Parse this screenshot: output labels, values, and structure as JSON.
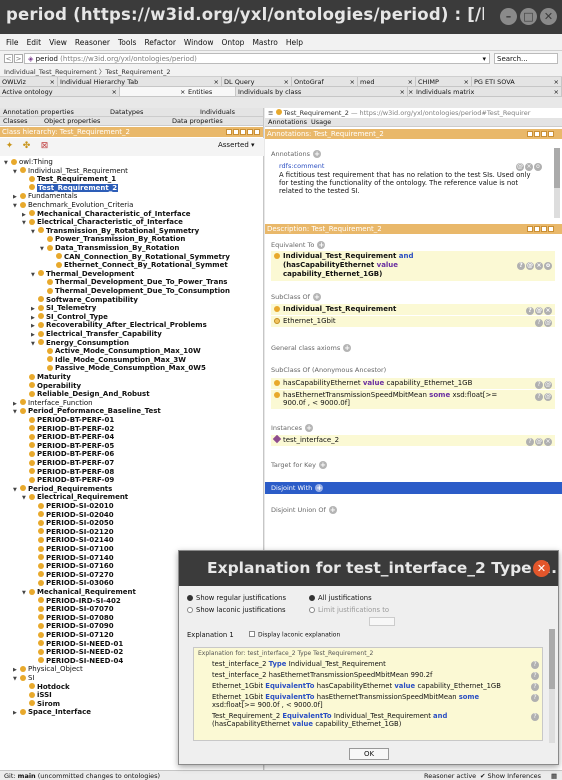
{
  "window": {
    "title": "period (https://w3id.org/yxl/ontologies/period) : [/hom..."
  },
  "menu": [
    "File",
    "Edit",
    "View",
    "Reasoner",
    "Tools",
    "Refactor",
    "Window",
    "Ontop",
    "Mastro",
    "Help"
  ],
  "address": {
    "nav_back": "<",
    "nav_fwd": ">",
    "ontology": "period",
    "url": "(https://w3id.org/yxl/ontologies/period)",
    "search": "Search...",
    "breadcrumb": "Individual_Test_Requirement 〉Test_Requirement_2"
  },
  "tabs_row1": [
    "OWLViz",
    "Individual Hierarchy Tab",
    "DL Query",
    "OntoGraf",
    "med",
    "CHIMP",
    "PG ETI SOVA"
  ],
  "tabs_row2": [
    "Active ontology",
    "Entities",
    "Individuals by class",
    "Individuals matrix"
  ],
  "left": {
    "subtabs_a": [
      "Annotation properties",
      "Datatypes",
      "Individuals"
    ],
    "subtabs_b": [
      "Classes",
      "Object properties",
      "Data properties"
    ],
    "panel_title": "Class hierarchy: Test_Requirement_2",
    "asserted": "Asserted",
    "tree": [
      {
        "label": "owl:Thing",
        "depth": 0,
        "tri": "▼",
        "bold": false
      },
      {
        "label": "Individual_Test_Requirement",
        "depth": 1,
        "tri": "▼",
        "bold": false
      },
      {
        "label": "Test_Requirement_1",
        "depth": 2,
        "tri": "",
        "bold": true
      },
      {
        "label": "Test_Requirement_2",
        "depth": 2,
        "tri": "",
        "bold": true,
        "selected": true
      },
      {
        "label": "Fundamentals",
        "depth": 1,
        "tri": "▶",
        "bold": false
      },
      {
        "label": "Benchmark_Evolution_Criteria",
        "depth": 1,
        "tri": "▼",
        "bold": false
      },
      {
        "label": "Mechanical_Characteristic_of_Interface",
        "depth": 2,
        "tri": "▶",
        "bold": true
      },
      {
        "label": "Electrical_Characteristic_of_Interface",
        "depth": 2,
        "tri": "▼",
        "bold": true
      },
      {
        "label": "Transmission_By_Rotational_Symmetry",
        "depth": 3,
        "tri": "▼",
        "bold": true
      },
      {
        "label": "Power_Transmission_By_Rotation",
        "depth": 4,
        "tri": "",
        "bold": true
      },
      {
        "label": "Data_Transmission_By_Rotation",
        "depth": 4,
        "tri": "▼",
        "bold": true
      },
      {
        "label": "CAN_Connection_By_Rotational_Symmetry",
        "depth": 5,
        "tri": "",
        "bold": true
      },
      {
        "label": "Ethernet_Connect_By_Rotational_Symmet",
        "depth": 5,
        "tri": "",
        "bold": true
      },
      {
        "label": "Thermal_Development",
        "depth": 3,
        "tri": "▼",
        "bold": true
      },
      {
        "label": "Thermal_Development_Due_To_Power_Trans",
        "depth": 4,
        "tri": "",
        "bold": true
      },
      {
        "label": "Thermal_Development_Due_To_Consumption",
        "depth": 4,
        "tri": "",
        "bold": true
      },
      {
        "label": "Software_Compatibility",
        "depth": 3,
        "tri": "",
        "bold": true
      },
      {
        "label": "SI_Telemetry",
        "depth": 3,
        "tri": "▶",
        "bold": true
      },
      {
        "label": "SI_Control_Type",
        "depth": 3,
        "tri": "▶",
        "bold": true
      },
      {
        "label": "Recoverability_After_Electrical_Problems",
        "depth": 3,
        "tri": "▶",
        "bold": true
      },
      {
        "label": "Electrical_Transfer_Capability",
        "depth": 3,
        "tri": "▶",
        "bold": true
      },
      {
        "label": "Energy_Consumption",
        "depth": 3,
        "tri": "▼",
        "bold": true
      },
      {
        "label": "Active_Mode_Consumption_Max_10W",
        "depth": 4,
        "tri": "",
        "bold": true
      },
      {
        "label": "Idle_Mode_Consumption_Max_3W",
        "depth": 4,
        "tri": "",
        "bold": true
      },
      {
        "label": "Passive_Mode_Consumption_Max_0W5",
        "depth": 4,
        "tri": "",
        "bold": true
      },
      {
        "label": "Maturity",
        "depth": 2,
        "tri": "",
        "bold": true
      },
      {
        "label": "Operability",
        "depth": 2,
        "tri": "",
        "bold": true
      },
      {
        "label": "Reliable_Design_And_Robust",
        "depth": 2,
        "tri": "",
        "bold": true
      },
      {
        "label": "Interface_Function",
        "depth": 1,
        "tri": "▶",
        "bold": false
      },
      {
        "label": "Period_Peformance_Baseline_Test",
        "depth": 1,
        "tri": "▼",
        "bold": true
      },
      {
        "label": "PERIOD-BT-PERF-01",
        "depth": 2,
        "tri": "",
        "bold": true
      },
      {
        "label": "PERIOD-BT-PERF-02",
        "depth": 2,
        "tri": "",
        "bold": true
      },
      {
        "label": "PERIOD-BT-PERF-04",
        "depth": 2,
        "tri": "",
        "bold": true
      },
      {
        "label": "PERIOD-BT-PERF-05",
        "depth": 2,
        "tri": "",
        "bold": true
      },
      {
        "label": "PERIOD-BT-PERF-06",
        "depth": 2,
        "tri": "",
        "bold": true
      },
      {
        "label": "PERIOD-BT-PERF-07",
        "depth": 2,
        "tri": "",
        "bold": true
      },
      {
        "label": "PERIOD-BT-PERF-08",
        "depth": 2,
        "tri": "",
        "bold": true
      },
      {
        "label": "PERIOD-BT-PERF-09",
        "depth": 2,
        "tri": "",
        "bold": true
      },
      {
        "label": "Period_Requirements",
        "depth": 1,
        "tri": "▼",
        "bold": true
      },
      {
        "label": "Electrical_Requirement",
        "depth": 2,
        "tri": "▼",
        "bold": true
      },
      {
        "label": "PERIOD-SI-02010",
        "depth": 3,
        "tri": "",
        "bold": true
      },
      {
        "label": "PERIOD-SI-02040",
        "depth": 3,
        "tri": "",
        "bold": true
      },
      {
        "label": "PERIOD-SI-02050",
        "depth": 3,
        "tri": "",
        "bold": true
      },
      {
        "label": "PERIOD-SI-02120",
        "depth": 3,
        "tri": "",
        "bold": true
      },
      {
        "label": "PERIOD-SI-02140",
        "depth": 3,
        "tri": "",
        "bold": true
      },
      {
        "label": "PERIOD-SI-07100",
        "depth": 3,
        "tri": "",
        "bold": true
      },
      {
        "label": "PERIOD-SI-07140",
        "depth": 3,
        "tri": "",
        "bold": true
      },
      {
        "label": "PERIOD-SI-07160",
        "depth": 3,
        "tri": "",
        "bold": true
      },
      {
        "label": "PERIOD-SI-07270",
        "depth": 3,
        "tri": "",
        "bold": true
      },
      {
        "label": "PERIOD-SI-03060",
        "depth": 3,
        "tri": "",
        "bold": true
      },
      {
        "label": "Mechanical_Requirement",
        "depth": 2,
        "tri": "▼",
        "bold": true
      },
      {
        "label": "PERIOD-IRD-SI-402",
        "depth": 3,
        "tri": "",
        "bold": true
      },
      {
        "label": "PERIOD-SI-07070",
        "depth": 3,
        "tri": "",
        "bold": true
      },
      {
        "label": "PERIOD-SI-07080",
        "depth": 3,
        "tri": "",
        "bold": true
      },
      {
        "label": "PERIOD-SI-07090",
        "depth": 3,
        "tri": "",
        "bold": true
      },
      {
        "label": "PERIOD-SI-07120",
        "depth": 3,
        "tri": "",
        "bold": true
      },
      {
        "label": "PERIOD-SI-NEED-01",
        "depth": 3,
        "tri": "",
        "bold": true
      },
      {
        "label": "PERIOD-SI-NEED-02",
        "depth": 3,
        "tri": "",
        "bold": true
      },
      {
        "label": "PERIOD-SI-NEED-04",
        "depth": 3,
        "tri": "",
        "bold": true
      },
      {
        "label": "Physical_Object",
        "depth": 1,
        "tri": "▶",
        "bold": false
      },
      {
        "label": "SI",
        "depth": 1,
        "tri": "▼",
        "bold": false
      },
      {
        "label": "Hotdock",
        "depth": 2,
        "tri": "",
        "bold": true
      },
      {
        "label": "iSSI",
        "depth": 2,
        "tri": "",
        "bold": true
      },
      {
        "label": "Sirom",
        "depth": 2,
        "tri": "",
        "bold": true
      },
      {
        "label": "Space_Interface",
        "depth": 1,
        "tri": "▶",
        "bold": true
      }
    ]
  },
  "right": {
    "entity_name": "Test_Requirement_2",
    "entity_iri": "— https://w3id.org/yxl/ontologies/period#Test_Requirer",
    "tabs": [
      "Annotations",
      "Usage"
    ],
    "annotations_title": "Annotations: Test_Requirement_2",
    "annotations_label": "Annotations",
    "rdfs_comment": "rdfs:comment",
    "comment_lines": [
      "A fictitious test requirement that has no relation to the test SIs. Used only",
      "for testing the functionality of the ontology. The reference value is not",
      "related to the tested SI."
    ],
    "description_title": "Description: Test_Requirement_2",
    "equivalent_to": "Equivalent To",
    "eq_class": "Individual_Test_Requirement",
    "eq_and": "and",
    "eq_prop": "(hasCapabilityEthernet",
    "eq_value": "value",
    "eq_tail": "capability_Ethernet_1GB)",
    "subclass_of": "SubClass Of",
    "sub_1": "Individual_Test_Requirement",
    "sub_2": "Ethernet_1Gbit",
    "general_axioms": "General class axioms",
    "subclass_anon": "SubClass Of (Anonymous Ancestor)",
    "anc_1_prop": "hasCapabilityEthernet",
    "anc_1_value": "value",
    "anc_1_tail": "capability_Ethernet_1GB",
    "anc_2_prop": "hasEthernetTransmissionSpeedMbitMean",
    "anc_2_some": "some",
    "anc_2_tail": "xsd:float[>=",
    "anc_2_line2": "900.0f , < 9000.0f]",
    "instances": "Instances",
    "instance_1": "test_interface_2",
    "target_for_key": "Target for Key",
    "disjoint_with": "Disjoint With",
    "disjoint_union": "Disjoint Union Of"
  },
  "dialog": {
    "title": "Explanation for test_interface_2 Type T...",
    "opt_regular": "Show regular justifications",
    "opt_all": "All justifications",
    "opt_laconic": "Show laconic justifications",
    "opt_limit": "Limit justifications to",
    "explanation_label": "Explanation 1",
    "display_laconic": "Display laconic explanation",
    "explanation_for": "Explanation for: test_interface_2 Type Test_Requirement_2",
    "lines": [
      {
        "a": "test_interface_2",
        "kw": "Type",
        "b": "Individual_Test_Requirement",
        "c": "",
        "kw2": "",
        "d": ""
      },
      {
        "a": "test_interface_2 hasEthernetTransmissionSpeedMbitMean 990.2f",
        "kw": "",
        "b": "",
        "c": "",
        "kw2": "",
        "d": ""
      },
      {
        "a": "Ethernet_1Gbit",
        "kw": "EquivalentTo",
        "b": "hasCapabilityEthernet",
        "c": "value",
        "kw2": "",
        "d": "capability_Ethernet_1GB"
      },
      {
        "a": "Ethernet_1Gbit",
        "kw": "EquivalentTo",
        "b": "hasEthernetTransmissionSpeedMbitMean",
        "c": "some",
        "kw2": "",
        "d": ""
      },
      {
        "a": "xsd:float[>= 900.0f , < 9000.0f]",
        "kw": "",
        "b": "",
        "c": "",
        "kw2": "",
        "d": ""
      },
      {
        "a": "Test_Requirement_2",
        "kw": "EquivalentTo",
        "b": "Individual_Test_Requirement",
        "c": "and",
        "kw2": "",
        "d": ""
      },
      {
        "a": "(hasCapabilityEthernet",
        "kw": "",
        "b": "",
        "c": "value",
        "kw2": "",
        "d": "capability_Ethernet_1GB)"
      }
    ],
    "ok": "OK"
  },
  "status": {
    "git_label": "Git:",
    "git_branch": "main",
    "git_note": "(uncommitted changes to ontologies)",
    "reasoner": "Reasoner active",
    "show_inferences": "Show Inferences"
  }
}
